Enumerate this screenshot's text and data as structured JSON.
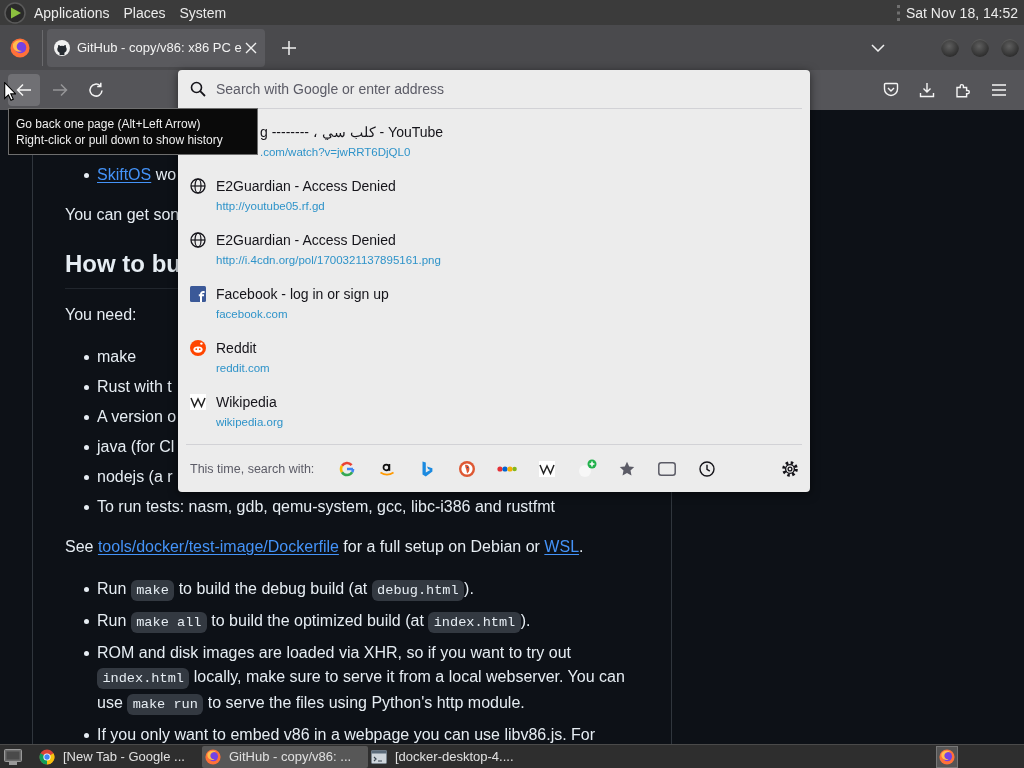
{
  "top_panel": {
    "menus": [
      "Applications",
      "Places",
      "System"
    ],
    "clock": "Sat Nov 18, 14:52"
  },
  "tabs": [
    {
      "title": "GitHub - copy/v86: x86 PC e",
      "selected": true
    }
  ],
  "nav_buttons": [
    {
      "kind": "back",
      "hovered": true,
      "disabled": false
    },
    {
      "kind": "forward",
      "hovered": false,
      "disabled": true
    },
    {
      "kind": "reload",
      "hovered": false,
      "disabled": false
    }
  ],
  "urlbar": {
    "placeholder": "Search with Google or enter address",
    "suggestions": [
      {
        "kind": "covered",
        "title": "g -------- ، كلب سي - YouTube",
        "url": ".com/watch?v=jwRRT6DjQL0"
      },
      {
        "kind": "globe",
        "title": "E2Guardian - Access Denied",
        "url": "http://youtube05.rf.gd"
      },
      {
        "kind": "globe",
        "title": "E2Guardian - Access Denied",
        "url": "http://i.4cdn.org/pol/1700321137895161.png"
      },
      {
        "kind": "facebook",
        "title": "Facebook - log in or sign up",
        "url": "facebook.com"
      },
      {
        "kind": "reddit",
        "title": "Reddit",
        "url": "reddit.com"
      },
      {
        "kind": "wikipedia",
        "title": "Wikipedia",
        "url": "wikipedia.org"
      }
    ],
    "search_with": "This time, search with:"
  },
  "tooltip": {
    "lines": [
      "Go back one page (Alt+Left Arrow)",
      "Right-click or pull down to show history"
    ]
  },
  "readme": [
    {
      "kind": "list",
      "items": [
        {
          "parts": [
            {
              "kind": "link",
              "text": "SkiftOS"
            },
            {
              "kind": "text",
              "text": " wo"
            }
          ]
        }
      ]
    },
    {
      "kind": "paragraph",
      "parts": [
        {
          "kind": "text",
          "text": "You can get son"
        }
      ]
    },
    {
      "kind": "heading",
      "parts": [
        {
          "kind": "text",
          "text": "How to bu"
        }
      ]
    },
    {
      "kind": "paragraph",
      "parts": [
        {
          "kind": "text",
          "text": "You need:"
        }
      ]
    },
    {
      "kind": "list",
      "items": [
        {
          "parts": [
            {
              "kind": "text",
              "text": "make"
            }
          ]
        },
        {
          "parts": [
            {
              "kind": "text",
              "text": "Rust with t"
            }
          ]
        },
        {
          "parts": [
            {
              "kind": "text",
              "text": "A version o"
            }
          ]
        },
        {
          "parts": [
            {
              "kind": "text",
              "text": "java (for Cl"
            }
          ]
        },
        {
          "parts": [
            {
              "kind": "text",
              "text": "nodejs (a r"
            }
          ]
        },
        {
          "parts": [
            {
              "kind": "text",
              "text": "To run tests: nasm, gdb, qemu-system, gcc, libc-i386 and rustfmt"
            }
          ]
        }
      ]
    },
    {
      "kind": "paragraph",
      "parts": [
        {
          "kind": "text",
          "text": "See "
        },
        {
          "kind": "link",
          "text": "tools/docker/test-image/Dockerfile"
        },
        {
          "kind": "text",
          "text": " for a full setup on Debian or "
        },
        {
          "kind": "link",
          "text": "WSL"
        },
        {
          "kind": "text",
          "text": "."
        }
      ]
    },
    {
      "kind": "list",
      "items": [
        {
          "parts": [
            {
              "kind": "text",
              "text": "Run "
            },
            {
              "kind": "code",
              "text": "make"
            },
            {
              "kind": "text",
              "text": " to build the debug build (at "
            },
            {
              "kind": "code",
              "text": "debug.html"
            },
            {
              "kind": "text",
              "text": ")."
            }
          ]
        },
        {
          "parts": [
            {
              "kind": "text",
              "text": "Run "
            },
            {
              "kind": "code",
              "text": "make all"
            },
            {
              "kind": "text",
              "text": " to build the optimized build (at "
            },
            {
              "kind": "code",
              "text": "index.html"
            },
            {
              "kind": "text",
              "text": ")."
            }
          ]
        },
        {
          "parts": [
            {
              "kind": "text",
              "text": "ROM and disk images are loaded via XHR, so if you want to try out "
            },
            {
              "kind": "code",
              "text": "index.html"
            },
            {
              "kind": "text",
              "text": " locally, make sure to serve it from a local webserver. You can use "
            },
            {
              "kind": "code",
              "text": "make run"
            },
            {
              "kind": "text",
              "text": " to serve the files using Python's http module."
            }
          ]
        },
        {
          "parts": [
            {
              "kind": "text",
              "text": "If you only want to embed v86 in a webpage you can use libv86.js. For"
            }
          ]
        }
      ]
    }
  ],
  "taskbar": {
    "tasks": [
      {
        "kind": "chrome",
        "title": "[New Tab - Google ...",
        "selected": false
      },
      {
        "kind": "firefox",
        "title": "GitHub - copy/v86: ...",
        "selected": true
      },
      {
        "kind": "window",
        "title": "[docker-desktop-4....",
        "selected": false
      }
    ]
  }
}
